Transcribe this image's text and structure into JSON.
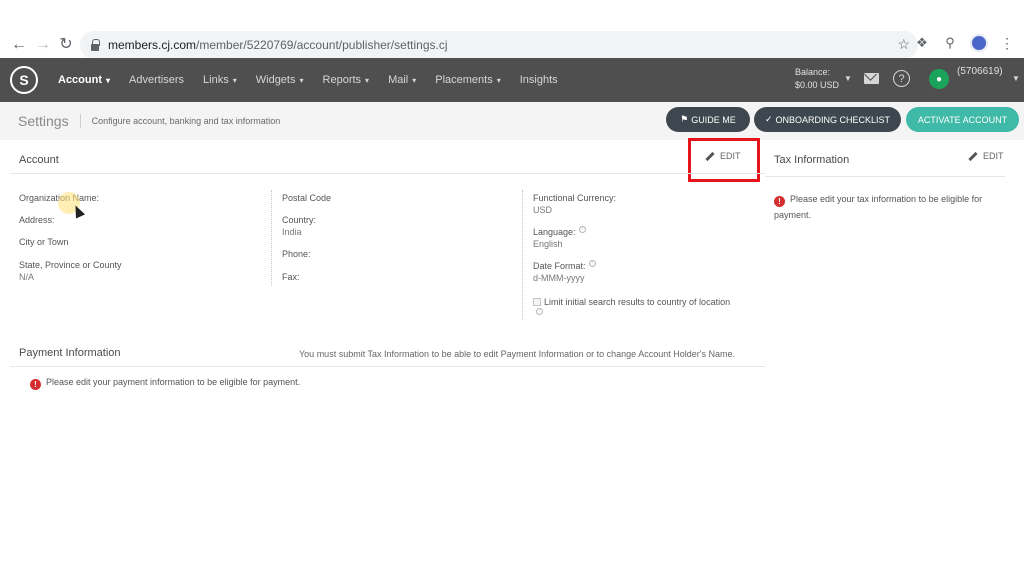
{
  "browser": {
    "url_host": "members.cj.com",
    "url_path": "/member/5220769/account/publisher/settings.cj"
  },
  "header": {
    "nav": [
      {
        "label": "Account",
        "active": true,
        "caret": true
      },
      {
        "label": "Advertisers",
        "active": false,
        "caret": false
      },
      {
        "label": "Links",
        "active": false,
        "caret": true
      },
      {
        "label": "Widgets",
        "active": false,
        "caret": true
      },
      {
        "label": "Reports",
        "active": false,
        "caret": true
      },
      {
        "label": "Mail",
        "active": false,
        "caret": true
      },
      {
        "label": "Placements",
        "active": false,
        "caret": true
      },
      {
        "label": "Insights",
        "active": false,
        "caret": false
      }
    ],
    "balance_label": "Balance:",
    "balance_value": "$0.00 USD",
    "user_id": "(5706619)"
  },
  "subheader": {
    "title": "Settings",
    "subtitle": "Configure account, banking and tax information",
    "guide_label": "GUIDE ME",
    "onboarding_label": "ONBOARDING CHECKLIST",
    "activate_label": "ACTIVATE ACCOUNT"
  },
  "account": {
    "title": "Account",
    "edit_label": "EDIT",
    "col1": {
      "org_name_label": "Organization Name:",
      "address_label": "Address:",
      "city_label": "City or Town",
      "state_label": "State, Province or County",
      "state_value": "N/A"
    },
    "col2": {
      "postal_label": "Postal Code",
      "country_label": "Country:",
      "country_value": "India",
      "phone_label": "Phone:",
      "fax_label": "Fax:"
    },
    "col3": {
      "currency_label": "Functional Currency:",
      "currency_value": "USD",
      "language_label": "Language:",
      "language_value": "English",
      "date_format_label": "Date Format:",
      "date_format_value": "d-MMM-yyyy",
      "limit_search_label": "Limit initial search results to country of location"
    }
  },
  "tax": {
    "title": "Tax Information",
    "edit_label": "EDIT",
    "alert": "Please edit your tax information to be eligible for payment."
  },
  "payment": {
    "title": "Payment Information",
    "notice": "You must submit Tax Information to be able to edit Payment Information or to change Account Holder's Name.",
    "alert": "Please edit your payment information to be eligible for payment."
  },
  "colors": {
    "header_bg": "#4f4f4f",
    "dark_button": "#3e474f",
    "activate_button": "#3fb9a8",
    "alert_red": "#d42e2e",
    "highlight_red": "#e8141c"
  }
}
